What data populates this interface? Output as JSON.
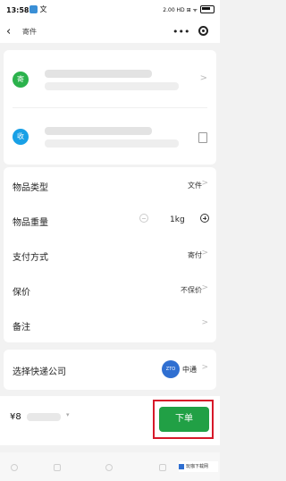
{
  "status_bar": {
    "time": "13:58",
    "app_badge": "文",
    "right_text": "2.00 HD ⊞ ᯤ"
  },
  "nav": {
    "back_icon": "‹",
    "title": "寄件",
    "more_icon": "•••"
  },
  "address": {
    "sender_badge": "寄",
    "receiver_badge": "收",
    "sender_color": "#2bb24c",
    "receiver_color": "#18a0e6"
  },
  "options": {
    "item_type": {
      "label": "物品类型",
      "value": "文件"
    },
    "weight": {
      "label": "物品重量",
      "value": "1kg"
    },
    "payment": {
      "label": "支付方式",
      "value": "寄付"
    },
    "insurance": {
      "label": "保价",
      "value": "不保价"
    },
    "remark": {
      "label": "备注",
      "value": ""
    }
  },
  "courier": {
    "label": "选择快递公司",
    "logo_text": "ZTO",
    "value": "中通"
  },
  "bottom": {
    "price": "¥8",
    "price_caret": "▾",
    "order_label": "下单",
    "order_color": "#21a045",
    "highlight_color": "#d7192a"
  },
  "watermark": "玩咖下载网"
}
